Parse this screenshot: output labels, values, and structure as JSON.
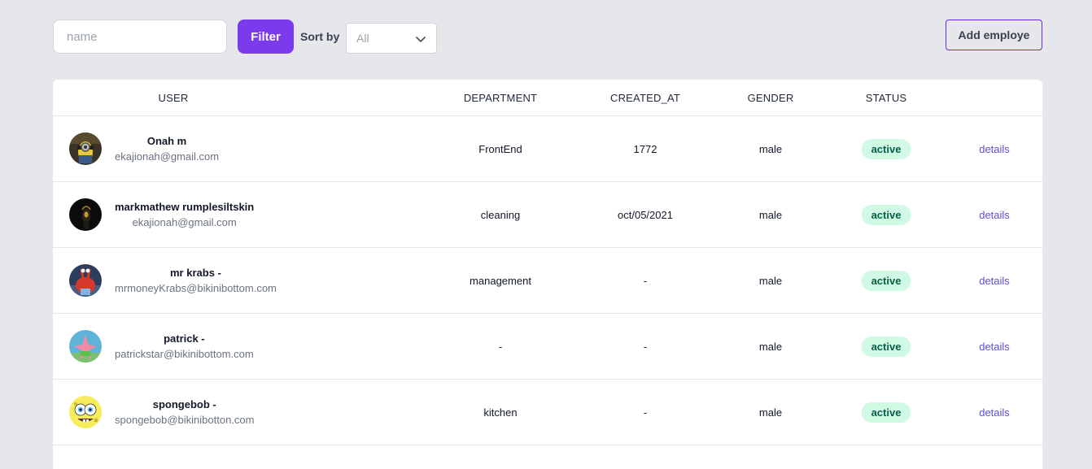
{
  "toolbar": {
    "name_placeholder": "name",
    "filter_label": "Filter",
    "sort_by_label": "Sort by",
    "sort_selected": "All",
    "add_label": "Add employe"
  },
  "table": {
    "headers": {
      "user": "USER",
      "department": "DEPARTMENT",
      "created_at": "CREATED_AT",
      "gender": "GENDER",
      "status": "STATUS"
    },
    "rows": [
      {
        "name": "Onah  m",
        "email": "ekajionah@gmail.com",
        "department": "FrontEnd",
        "created_at": "1772",
        "gender": "male",
        "status": "active",
        "action": "details",
        "avatar": "minion-avatar-icon"
      },
      {
        "name": "markmathew  rumplesiltskin",
        "email": "ekajionah@gmail.com",
        "department": "cleaning",
        "created_at": "oct/05/2021",
        "gender": "male",
        "status": "active",
        "action": "details",
        "avatar": "dark-character-avatar-icon"
      },
      {
        "name": "mr krabs  -",
        "email": "mrmoneyKrabs@bikinibottom.com",
        "department": "management",
        "created_at": "-",
        "gender": "male",
        "status": "active",
        "action": "details",
        "avatar": "crab-avatar-icon"
      },
      {
        "name": "patrick  -",
        "email": "patrickstar@bikinibottom.com",
        "department": "-",
        "created_at": "-",
        "gender": "male",
        "status": "active",
        "action": "details",
        "avatar": "starfish-avatar-icon"
      },
      {
        "name": "spongebob  -",
        "email": "spongebob@bikinibotton.com",
        "department": "kitchen",
        "created_at": "-",
        "gender": "male",
        "status": "active",
        "action": "details",
        "avatar": "sponge-avatar-icon"
      }
    ]
  },
  "colors": {
    "page_bg": "#e5e7eb",
    "accent": "#7c3aed",
    "badge_bg": "#d1fae5",
    "badge_text": "#065f46",
    "link": "#5b4fd6"
  }
}
